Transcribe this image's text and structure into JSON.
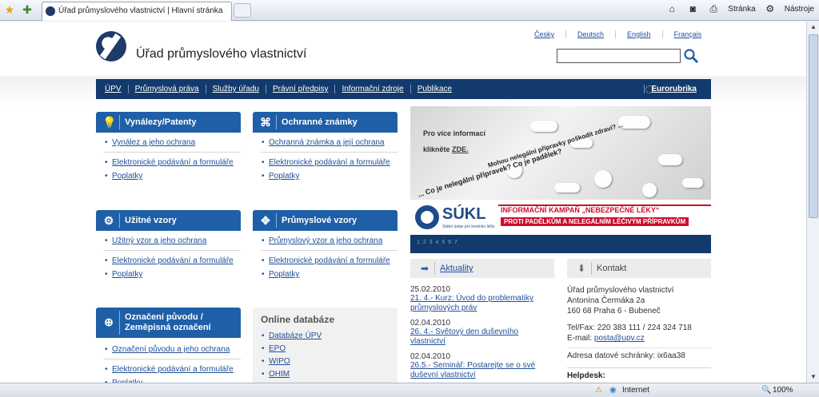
{
  "browser": {
    "tab_title": "Úřad průmyslového vlastnictví | Hlavní stránka",
    "tools": {
      "page_label": "Stránka",
      "tools_label": "Nástroje"
    },
    "status": {
      "zone": "Internet",
      "zoom": "100%"
    }
  },
  "header": {
    "site_name": "Úřad průmyslového vlastnictví",
    "languages": [
      "Česky",
      "Deutsch",
      "English",
      "Français"
    ],
    "search_value": ""
  },
  "nav": {
    "items": [
      "ÚPV",
      "Průmyslová práva",
      "Služby úřadu",
      "Právní předpisy",
      "Informační zdroje",
      "Publikace"
    ],
    "eurorubrika": "Eurorubrika"
  },
  "blocks": [
    {
      "title": "Vynálezy/Patenty",
      "first": "Vynález a jeho ochrana",
      "links": [
        "Elektronické podávání a formuláře",
        "Poplatky"
      ]
    },
    {
      "title": "Ochranné známky",
      "first": "Ochranná známka a její ochrana",
      "links": [
        "Elektronické podávání a formuláře",
        "Poplatky"
      ]
    },
    {
      "title": "Užitné vzory",
      "first": "Užitný vzor a jeho ochrana",
      "links": [
        "Elektronické podávání a formuláře",
        "Poplatky"
      ]
    },
    {
      "title": "Průmyslové vzory",
      "first": "Průmyslový vzor a jeho ochrana",
      "links": [
        "Elektronické podávání a formuláře",
        "Poplatky"
      ]
    },
    {
      "title_line1": "Označení původu /",
      "title_line2": "Zeměpisná označení",
      "first": "Označení původu a jeho ochrana",
      "links": [
        "Elektronické podávání a formuláře",
        "Poplatky"
      ]
    }
  ],
  "online": {
    "title": "Online databáze",
    "items": [
      "Databáze ÚPV",
      "EPO",
      "WIPO",
      "OHIM"
    ]
  },
  "banner": {
    "info_line1": "Pro více informací",
    "info_line2_prefix": "klikněte ",
    "info_link": "ZDE.",
    "slogan1": "... Co je nelegální přípravek? Co je padělek?",
    "slogan2": "Mohou nelegální přípravky poškodit zdraví? ...",
    "sukl_name": "SÚKL",
    "sukl_sub": "Státní ústav pro kontrolu léčiv",
    "campaign1": "INFORMAČNÍ KAMPAŇ „NEBEZPEČNÉ LÉKY“",
    "campaign2": "PROTI PADĚLKŮM A NELEGÁLNÍM LÉČIVÝM PŘÍPRAVKŮM",
    "slides": "1 2 3 4 5 6 7"
  },
  "news": {
    "title": "Aktuality",
    "items": [
      {
        "date": "25.02.2010",
        "text": "21. 4.- Kurz: Úvod do problematiky průmyslových práv"
      },
      {
        "date": "02.04.2010",
        "text": "26. 4.- Světový den duševního vlastnictví"
      },
      {
        "date": "02.04.2010",
        "text": "26.5.- Seminář: Postarejte se o své duševní vlastnictví"
      }
    ]
  },
  "contact": {
    "title": "Kontakt",
    "org": "Úřad průmyslového vlastnictví",
    "street": "Antonína Čermáka 2a",
    "city": "160 68 Praha 6 - Bubeneč",
    "tel": "Tel/Fax: 220 383 111 / 224 324 718",
    "email_prefix": "E-mail: ",
    "email": "posta@upv.cz",
    "datova": "Adresa datové schránky: ix6aa38",
    "helpdesk": "Helpdesk:"
  }
}
